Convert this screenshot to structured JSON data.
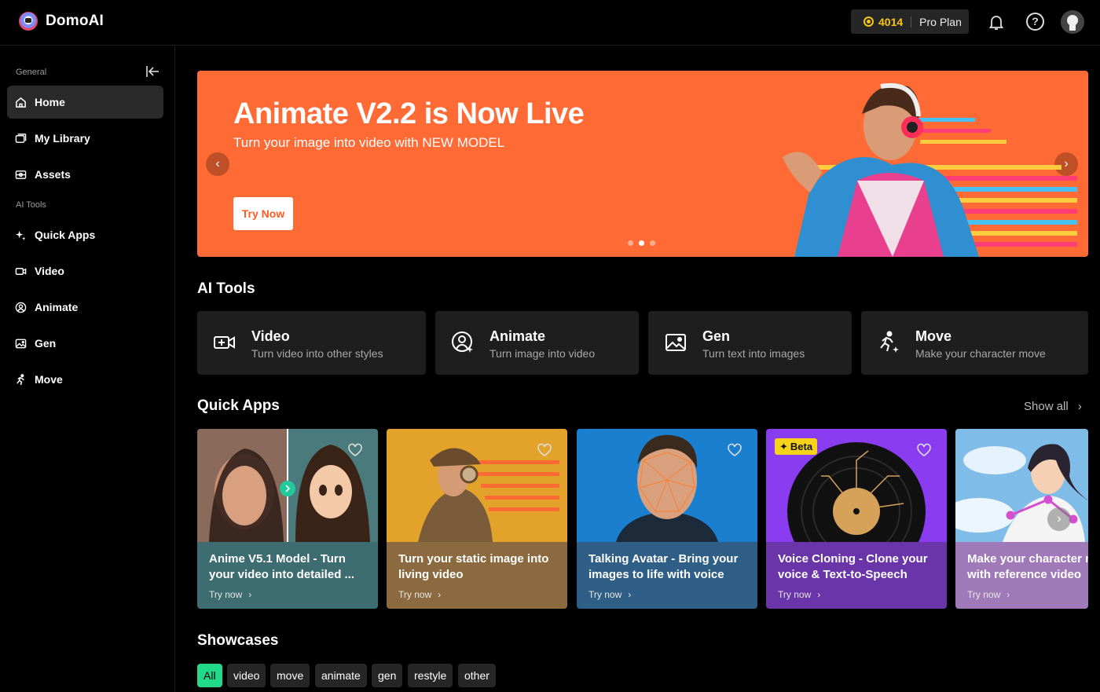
{
  "header": {
    "brand": "DomoAI",
    "credits": "4014",
    "plan": "Pro Plan"
  },
  "sidebar": {
    "general_label": "General",
    "tools_label": "AI Tools",
    "items": [
      {
        "label": "Home",
        "icon": "home-icon"
      },
      {
        "label": "My Library",
        "icon": "library-icon"
      },
      {
        "label": "Assets",
        "icon": "assets-icon"
      },
      {
        "label": "Quick Apps",
        "icon": "sparkle-icon"
      },
      {
        "label": "Video",
        "icon": "video-icon"
      },
      {
        "label": "Animate",
        "icon": "animate-icon"
      },
      {
        "label": "Gen",
        "icon": "image-icon"
      },
      {
        "label": "Move",
        "icon": "run-icon"
      }
    ]
  },
  "banner": {
    "title": "Animate V2.2 is Now Live",
    "subtitle": "Turn your image into video with NEW MODEL",
    "button": "Try Now",
    "active_slide": 2,
    "slide_count": 3
  },
  "ai_tools": {
    "title": "AI Tools",
    "items": [
      {
        "name": "Video",
        "desc": "Turn video into other styles"
      },
      {
        "name": "Animate",
        "desc": "Turn image into video"
      },
      {
        "name": "Gen",
        "desc": "Turn text into images"
      },
      {
        "name": "Move",
        "desc": "Make your character move"
      }
    ]
  },
  "quick_apps": {
    "title": "Quick Apps",
    "show_all": "Show all",
    "items": [
      {
        "title": "Anime V5.1 Model - Turn your video into detailed ...",
        "try": "Try now"
      },
      {
        "title": "Turn your static image into living video",
        "try": "Try now"
      },
      {
        "title": "Talking Avatar - Bring your images to life with voice",
        "try": "Try now"
      },
      {
        "title": "Voice Cloning - Clone your voice & Text-to-Speech",
        "try": "Try now",
        "badge": "Beta"
      },
      {
        "title": "Make your character move with reference video",
        "try": "Try now"
      }
    ]
  },
  "showcases": {
    "title": "Showcases",
    "filters": [
      "All",
      "video",
      "move",
      "animate",
      "gen",
      "restyle",
      "other"
    ]
  },
  "colors": {
    "banner": "#ff6a35",
    "accent_green": "#22d98a",
    "credit_gold": "#f5c518"
  }
}
